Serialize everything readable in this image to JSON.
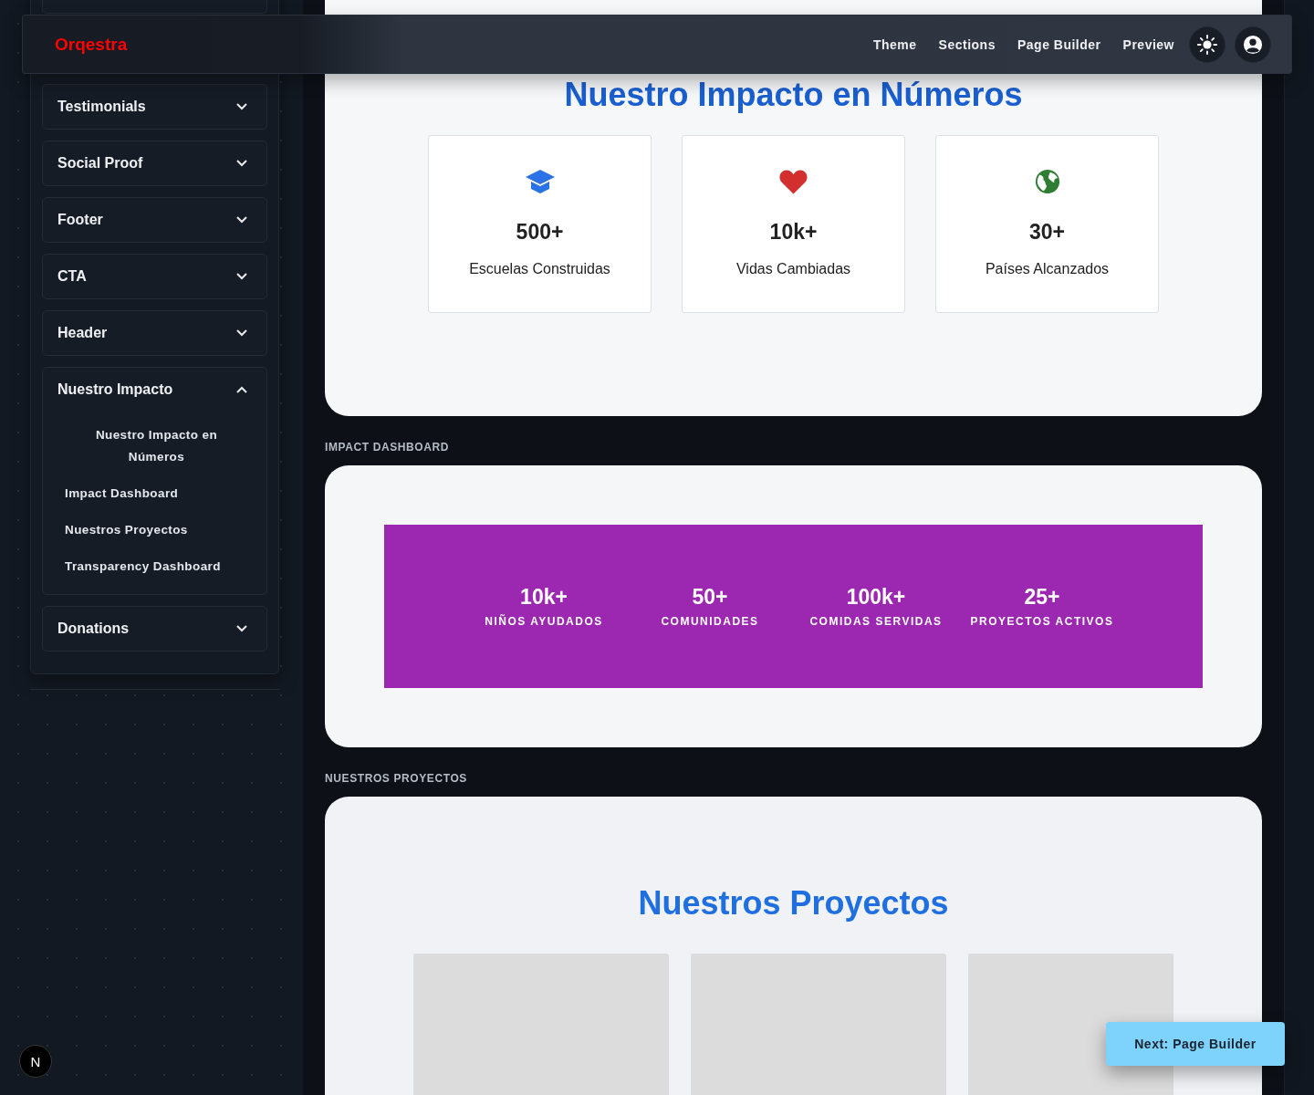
{
  "header": {
    "logo": "Orqestra",
    "nav": [
      "Theme",
      "Sections",
      "Page Builder",
      "Preview"
    ]
  },
  "sidebar": {
    "sections": [
      {
        "title": "Testimonials",
        "expanded": false
      },
      {
        "title": "Social Proof",
        "expanded": false
      },
      {
        "title": "Footer",
        "expanded": false
      },
      {
        "title": "CTA",
        "expanded": false
      },
      {
        "title": "Header",
        "expanded": false
      },
      {
        "title": "Nuestro Impacto",
        "expanded": true,
        "children": [
          {
            "label": "Nuestro Impacto en Números",
            "kind": "heading"
          },
          {
            "label": "Impact Dashboard",
            "kind": "link"
          },
          {
            "label": "Nuestros Proyectos",
            "kind": "link"
          },
          {
            "label": "Transparency Dashboard",
            "kind": "link"
          }
        ]
      },
      {
        "title": "Donations",
        "expanded": false
      }
    ]
  },
  "main": {
    "sections": [
      {
        "kind": "stats_cards",
        "heading": "Nuestro Impacto en Números",
        "stats": [
          {
            "value": "500+",
            "label": "Escuelas Construidas"
          },
          {
            "value": "10k+",
            "label": "Vidas Cambiadas"
          },
          {
            "value": "30+",
            "label": "Países Alcanzados"
          }
        ]
      },
      {
        "kind": "impact_band",
        "label": "IMPACT DASHBOARD",
        "stats": [
          {
            "value": "10k+",
            "label": "NIÑOS AYUDADOS"
          },
          {
            "value": "50+",
            "label": "COMUNIDADES"
          },
          {
            "value": "100k+",
            "label": "COMIDAS SERVIDAS"
          },
          {
            "value": "25+",
            "label": "PROYECTOS ACTIVOS"
          }
        ]
      },
      {
        "kind": "projects",
        "label": "NUESTROS PROYECTOS",
        "heading": "Nuestros Proyectos"
      }
    ]
  },
  "next_button": "Next: Page Builder",
  "dev_badge": "N"
}
